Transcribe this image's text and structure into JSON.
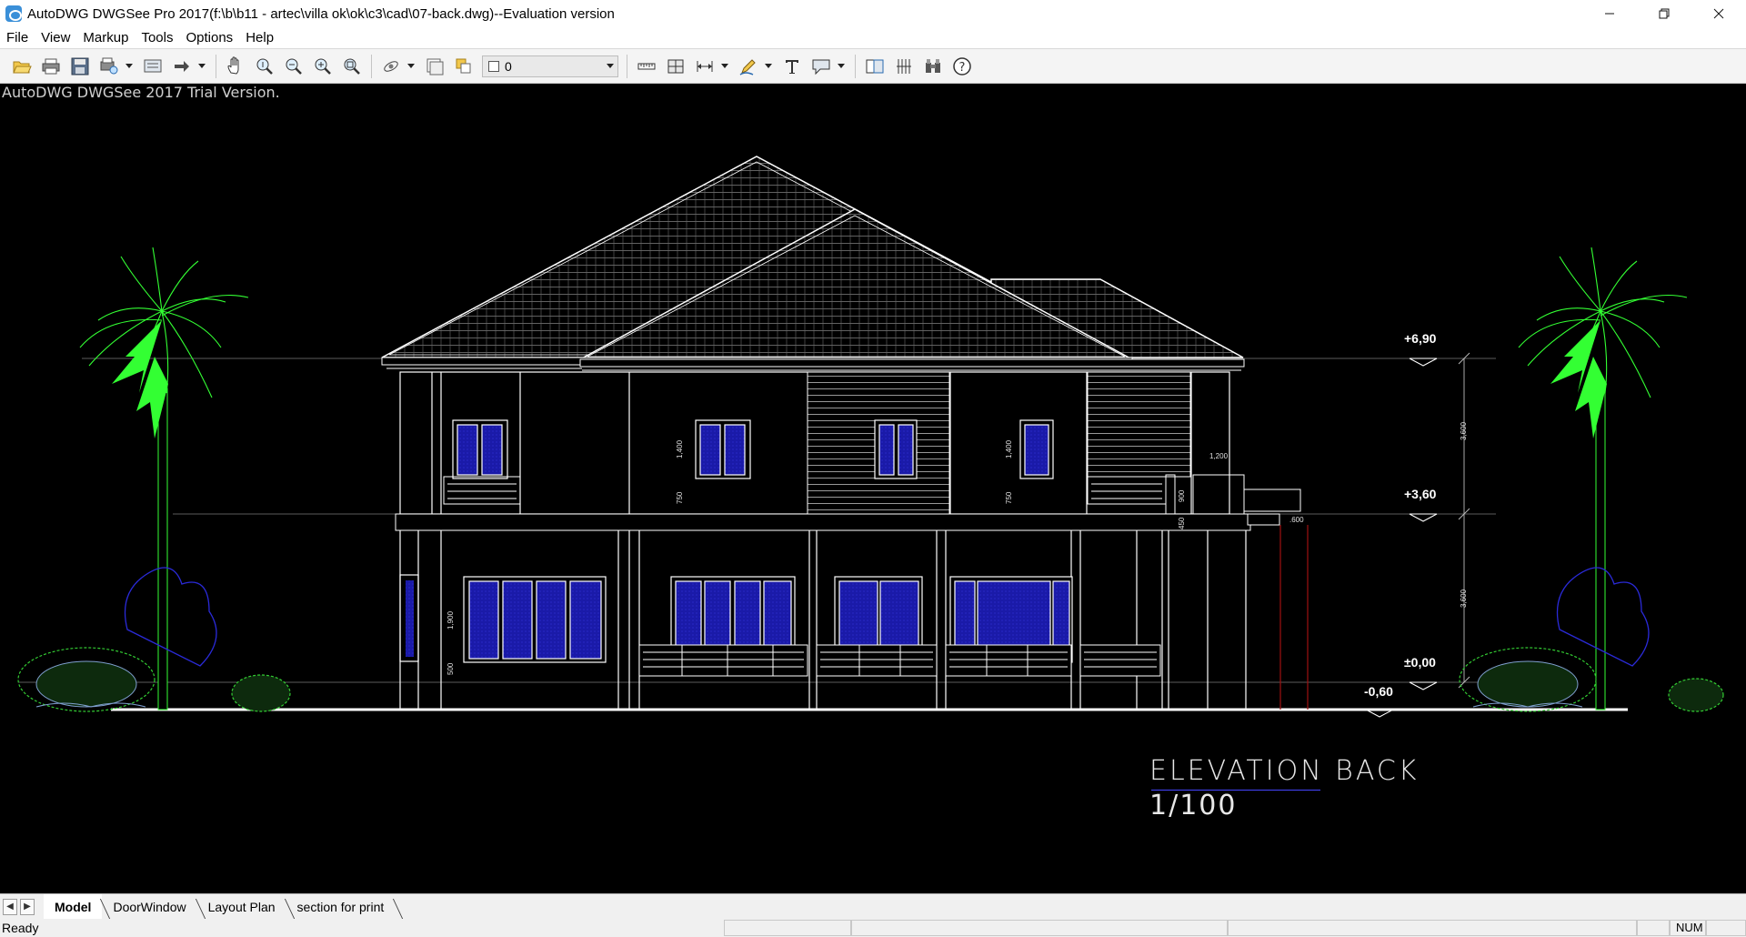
{
  "window": {
    "title": "AutoDWG DWGSee Pro 2017(f:\\b\\b11 - artec\\villa ok\\ok\\c3\\cad\\07-back.dwg)--Evaluation version",
    "minimize_icon": "minimize-icon",
    "maximize_icon": "restore-icon",
    "close_icon": "close-icon"
  },
  "menu": {
    "items": [
      "File",
      "View",
      "Markup",
      "Tools",
      "Options",
      "Help"
    ]
  },
  "toolbar": {
    "layer_value": "0",
    "icons": [
      "open-folder-icon",
      "print-icon",
      "save-icon",
      "print-preview-icon",
      "view-icon",
      "arrow-right-icon",
      "pan-hand-icon",
      "zoom-realtime-icon",
      "zoom-out-icon",
      "zoom-in-icon",
      "zoom-window-icon",
      "orbit-icon",
      "layout-icon",
      "layers-icon",
      "measure-distance-icon",
      "measure-area-icon",
      "dimension-icon",
      "pencil-markup-icon",
      "text-icon",
      "callout-icon",
      "compare-icon",
      "hatch-icon",
      "find-icon",
      "help-icon"
    ]
  },
  "canvas": {
    "trial_notice": "AutoDWG DWGSee 2017 Trial Version.",
    "background": "#000000",
    "line_color": "#ffffff",
    "glass_color": "#1a1aa8",
    "palm_color": "#33ff33",
    "shrub_color": "#2a2ad8",
    "caption_title": "ELEVATION  BACK",
    "caption_scale": "1/100",
    "levels": [
      "+6,90",
      "+3,60",
      "±0,00",
      "-0,60"
    ],
    "dimensions": [
      "3,600",
      "3,600",
      "1,400",
      "1,400",
      "750",
      "750",
      "1,900",
      "500",
      "1,200",
      "900",
      "450",
      ".600"
    ]
  },
  "tabs": {
    "items": [
      "Model",
      "DoorWindow",
      "Layout Plan",
      "section for print"
    ],
    "active": "Model"
  },
  "status": {
    "text": "Ready",
    "num": "NUM"
  }
}
